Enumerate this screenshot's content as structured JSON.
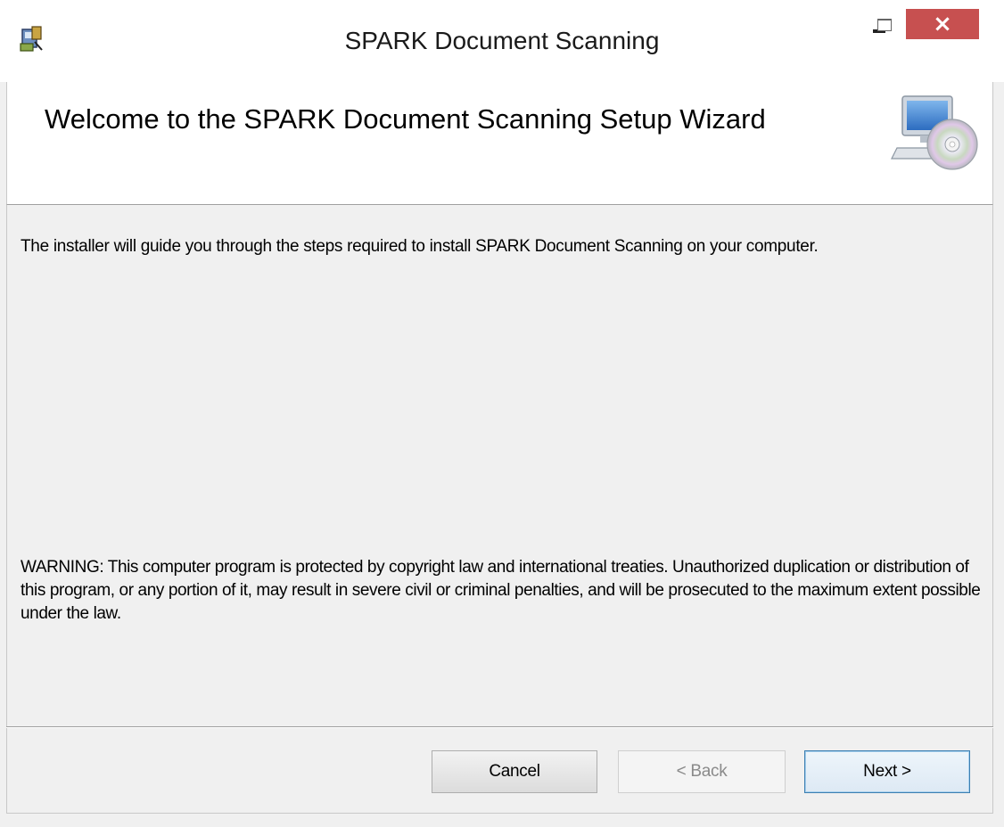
{
  "window": {
    "title": "SPARK Document Scanning",
    "controls": {
      "minimize_icon": "minimize-icon",
      "maximize_icon": "maximize-icon",
      "close_icon": "close-icon",
      "close_glyph": "×"
    },
    "close_color": "#c75050"
  },
  "header": {
    "title": "Welcome to the SPARK Document Scanning Setup Wizard",
    "icon": "computer-cd-icon"
  },
  "body": {
    "intro": "The installer will guide you through the steps required to install SPARK Document Scanning on your computer.",
    "warning": "WARNING: This computer program is protected by copyright law and international treaties. Unauthorized duplication or distribution of this program, or any portion of it, may result in severe civil or criminal penalties, and will be prosecuted to the maximum extent possible under the law."
  },
  "footer": {
    "cancel_label": "Cancel",
    "back_label": "< Back",
    "next_label": "Next >",
    "back_enabled": false,
    "default_button_border": "#3c7fb1"
  }
}
